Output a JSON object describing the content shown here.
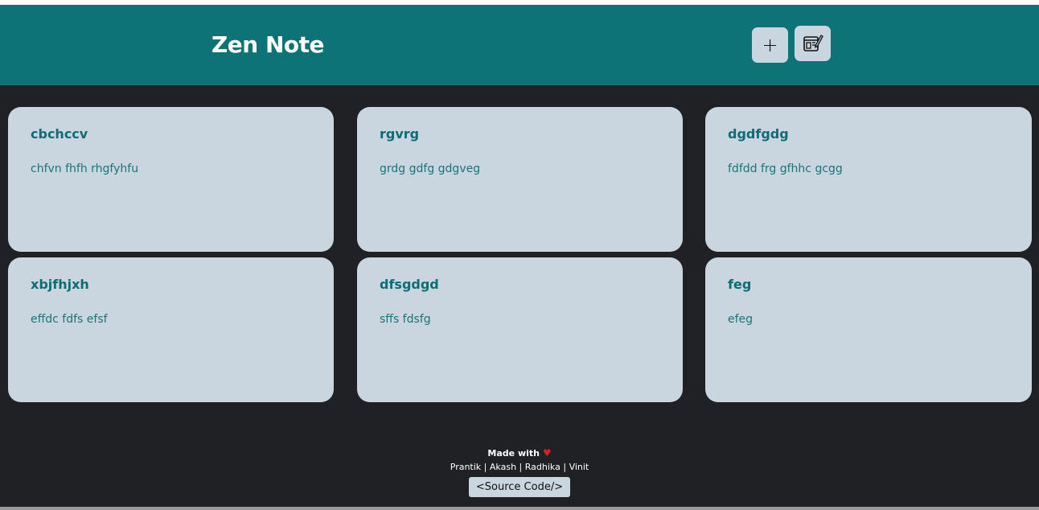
{
  "app": {
    "title": "Zen Note"
  },
  "header": {
    "add_button_label": "+",
    "edit_icon": "notepad-pencil-icon"
  },
  "notes": [
    {
      "title": "cbchccv",
      "body": "chfvn fhfh rhgfyhfu"
    },
    {
      "title": "rgvrg",
      "body": "grdg gdfg gdgveg"
    },
    {
      "title": "dgdfgdg",
      "body": "fdfdd frg gfhhc gcgg"
    },
    {
      "title": "xbjfhjxh",
      "body": "effdc fdfs efsf"
    },
    {
      "title": "dfsgdgd",
      "body": "sffs fdsfg"
    },
    {
      "title": "feg",
      "body": "efeg"
    }
  ],
  "footer": {
    "made_with": "Made with",
    "heart": "♥",
    "authors": [
      "Prantik",
      "Akash",
      "Radhika",
      "Vinit"
    ],
    "separator": "|",
    "source_button": "<Source Code/>"
  },
  "colors": {
    "header_bg": "#0e7377",
    "page_bg": "#202124",
    "card_bg": "#c9d6df",
    "card_text": "#0e6d72",
    "heart": "#d32027"
  }
}
